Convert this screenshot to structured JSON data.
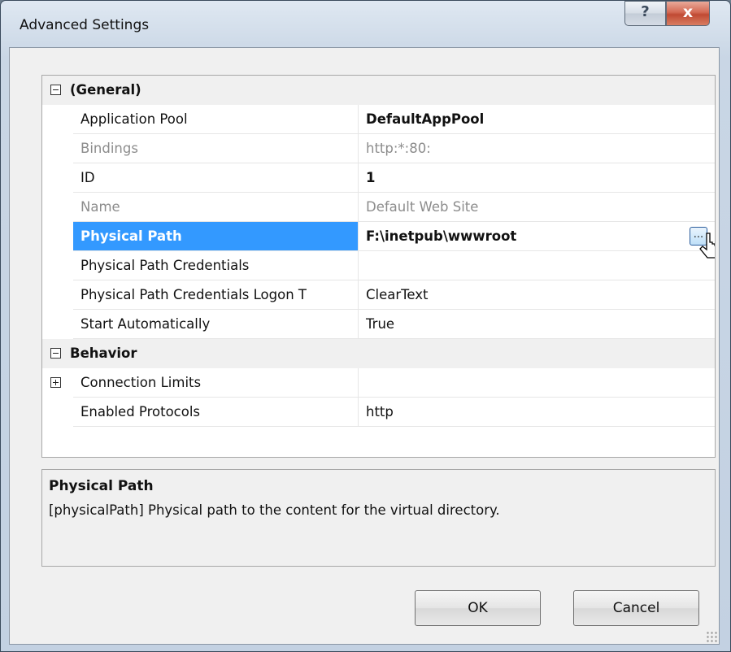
{
  "window": {
    "title": "Advanced Settings",
    "help_label": "?",
    "close_label": "x"
  },
  "grid": {
    "categories": [
      {
        "name": "(General)",
        "properties": [
          {
            "name": "Application Pool",
            "value": "DefaultAppPool"
          },
          {
            "name": "Bindings",
            "value": "http:*:80:"
          },
          {
            "name": "ID",
            "value": "1"
          },
          {
            "name": "Name",
            "value": "Default Web Site"
          },
          {
            "name": "Physical Path",
            "value": "F:\\inetpub\\wwwroot"
          },
          {
            "name": "Physical Path Credentials",
            "value": ""
          },
          {
            "name": "Physical Path Credentials Logon T",
            "value": "ClearText"
          },
          {
            "name": "Start Automatically",
            "value": "True"
          }
        ]
      },
      {
        "name": "Behavior",
        "properties": [
          {
            "name": "Connection Limits",
            "value": ""
          },
          {
            "name": "Enabled Protocols",
            "value": "http"
          }
        ]
      }
    ],
    "ellipsis_label": "..."
  },
  "description": {
    "title": "Physical Path",
    "text": "[physicalPath] Physical path to the content for the virtual directory."
  },
  "buttons": {
    "ok": "OK",
    "cancel": "Cancel"
  }
}
